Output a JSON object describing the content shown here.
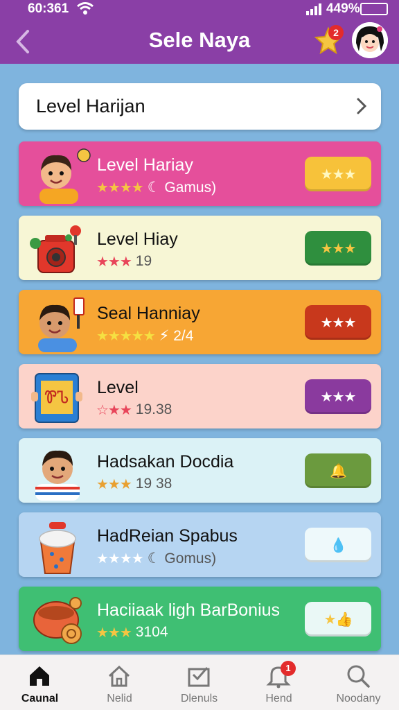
{
  "status_bar": {
    "time": "60:361",
    "battery": "449%"
  },
  "header": {
    "title": "Sele Naya",
    "notification_count": "2"
  },
  "top_row": {
    "label": "Level Harijan"
  },
  "levels": [
    {
      "title": "Level Hariay",
      "rating": "★★★★",
      "sub": "☾ Gamus)",
      "action": "★★★",
      "bg": "#e54f9b",
      "action_bg": "#f7c23a",
      "action_color": "#fff8c0",
      "text_light": true
    },
    {
      "title": "Level Hiay",
      "rating": "★★★",
      "sub": "19",
      "action": "★★★",
      "bg": "#f7f6d5",
      "action_bg": "#2f8f3e",
      "action_color": "#f5c542",
      "text_light": false
    },
    {
      "title": "Seal Hanniay",
      "rating": "★★★★★",
      "sub": "⚡ 2/4",
      "action": "★★★",
      "bg": "#f7a634",
      "action_bg": "#c8381c",
      "action_color": "#ffffff",
      "text_light": false
    },
    {
      "title": "Level",
      "rating": "☆★★",
      "sub": "19.38",
      "action": "★★★",
      "bg": "#fcd3ca",
      "action_bg": "#8a3a9e",
      "action_color": "#ffffff",
      "text_light": false
    },
    {
      "title": "Hadsakan Docdia",
      "rating": "★★★",
      "sub": "19 38",
      "action": "🔔",
      "bg": "#dbf2f6",
      "action_bg": "#6b9a3e",
      "action_color": "#f5a623",
      "text_light": false
    },
    {
      "title": "HadReian Spabus",
      "rating": "★★★★",
      "sub": "☾ Gomus)",
      "action": "💧",
      "bg": "#b6d5f2",
      "action_bg": "#eef9fb",
      "action_color": "#f0a81b",
      "text_light": false
    },
    {
      "title": "Haciiaak ligh BarBonius",
      "rating": "★★★",
      "sub": "3104",
      "action": "★👍",
      "bg": "#3fbf73",
      "action_bg": "#eaf8f6",
      "action_color": "#f5c542",
      "text_light": true
    }
  ],
  "nav": [
    {
      "label": "Caunal",
      "icon": "home-icon",
      "active": true
    },
    {
      "label": "Nelid",
      "icon": "house-outline-icon",
      "active": false
    },
    {
      "label": "Dlenuls",
      "icon": "inbox-check-icon",
      "active": false
    },
    {
      "label": "Hend",
      "icon": "bell-icon",
      "active": false,
      "badge": "1"
    },
    {
      "label": "Noodany",
      "icon": "search-icon",
      "active": false
    }
  ]
}
